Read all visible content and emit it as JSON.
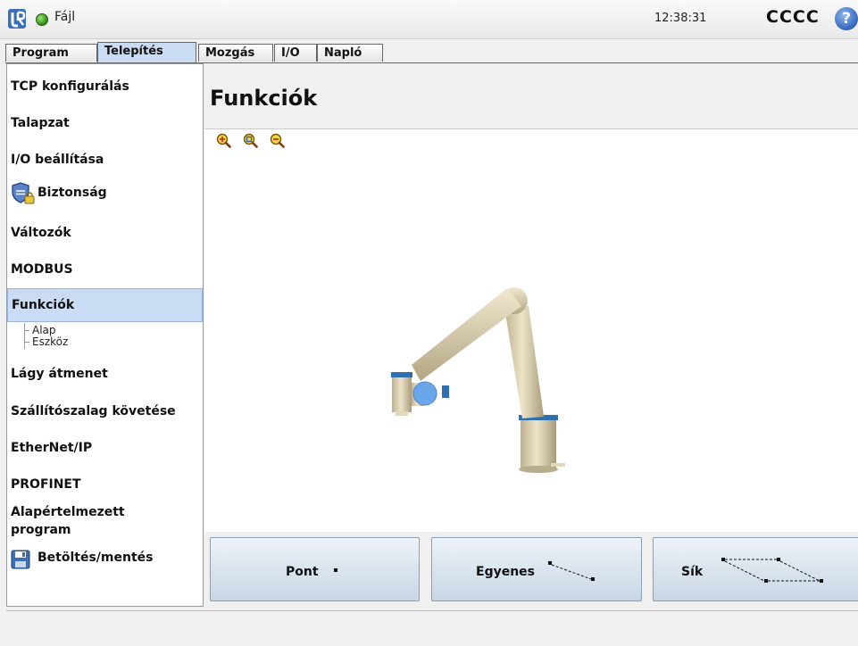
{
  "header": {
    "file_menu": "Fájl",
    "time": "12:38:31",
    "robot_name": "CCCC",
    "help": "?"
  },
  "tabs": [
    {
      "label": "Program",
      "active": false
    },
    {
      "label": "Telepítés",
      "active": true
    },
    {
      "label": "Mozgás",
      "active": false
    },
    {
      "label": "I/O",
      "active": false
    },
    {
      "label": "Napló",
      "active": false
    }
  ],
  "sidebar": {
    "items": [
      {
        "label": "TCP konfigurálás"
      },
      {
        "label": "Talapzat"
      },
      {
        "label": "I/O beállítása"
      },
      {
        "label": "Biztonság"
      },
      {
        "label": "Változók"
      },
      {
        "label": "MODBUS"
      },
      {
        "label": "Funkciók",
        "selected": true
      },
      {
        "label": "Lágy átmenet"
      },
      {
        "label": "Szállítószalag követése"
      },
      {
        "label": "EtherNet/IP"
      },
      {
        "label": "PROFINET"
      },
      {
        "label": "Alapértelmezett"
      },
      {
        "label": "program"
      },
      {
        "label": "Betöltés/mentés"
      }
    ],
    "sub_items": [
      {
        "label": "Alap"
      },
      {
        "label": "Eszköz"
      }
    ]
  },
  "main": {
    "title": "Funkciók"
  },
  "zoom": [
    "zoom-in-icon",
    "zoom-reset-icon",
    "zoom-out-icon"
  ],
  "buttons": {
    "point": "Pont",
    "line": "Egyenes",
    "plane": "Sík"
  },
  "colors": {
    "tab_active": "#c9dcf3",
    "selected_item": "#c9dcf3",
    "robot_joint": "#2f6fb0",
    "tcp_ball": "#6aa7ea"
  }
}
